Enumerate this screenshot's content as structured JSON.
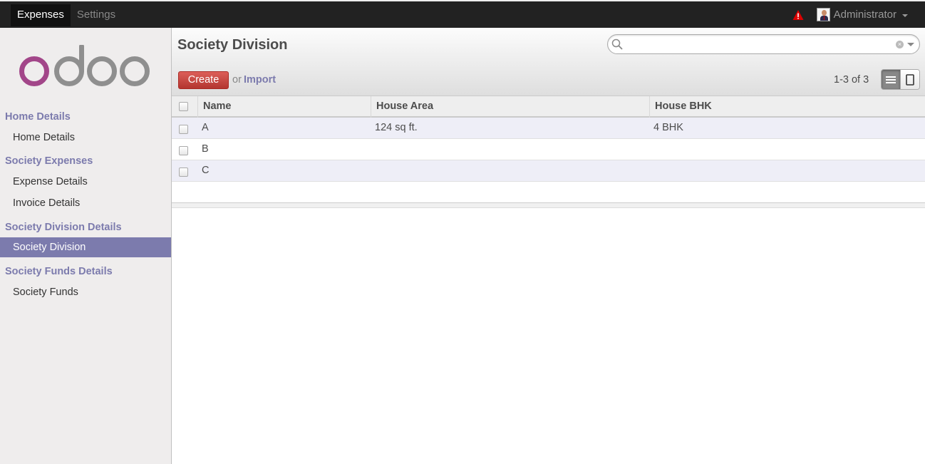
{
  "topbar": {
    "tabs": [
      {
        "label": "Expenses",
        "active": true
      },
      {
        "label": "Settings",
        "active": false
      }
    ],
    "user": "Administrator",
    "icons": [
      "warning-icon",
      "avatar",
      "caret-down-icon"
    ],
    "warning_color": "#dd0000"
  },
  "sidebar": {
    "logo_text": "odoo",
    "sections": [
      {
        "title": "Home Details",
        "items": [
          {
            "label": "Home Details",
            "active": false
          }
        ]
      },
      {
        "title": "Society Expenses",
        "items": [
          {
            "label": "Expense Details",
            "active": false
          },
          {
            "label": "Invoice Details",
            "active": false
          }
        ]
      },
      {
        "title": "Society Division Details",
        "items": [
          {
            "label": "Society Division",
            "active": true
          }
        ]
      },
      {
        "title": "Society Funds Details",
        "items": [
          {
            "label": "Society Funds",
            "active": false
          }
        ]
      }
    ],
    "accent_color": "#7c7bad"
  },
  "main": {
    "title": "Society Division",
    "search": {
      "value": "",
      "placeholder": ""
    },
    "create_label": "Create",
    "or_label": "or",
    "import_label": "Import",
    "pager": "1-3 of 3",
    "view_switch": [
      {
        "icon": "list-view-icon",
        "active": true
      },
      {
        "icon": "form-view-icon",
        "active": false
      }
    ],
    "create_color": "#c9302c"
  },
  "table": {
    "columns": [
      "Name",
      "House Area",
      "House BHK"
    ],
    "rows": [
      [
        "A",
        "124 sq ft.",
        "4 BHK"
      ],
      [
        "B",
        "",
        ""
      ],
      [
        "C",
        "",
        ""
      ]
    ]
  }
}
